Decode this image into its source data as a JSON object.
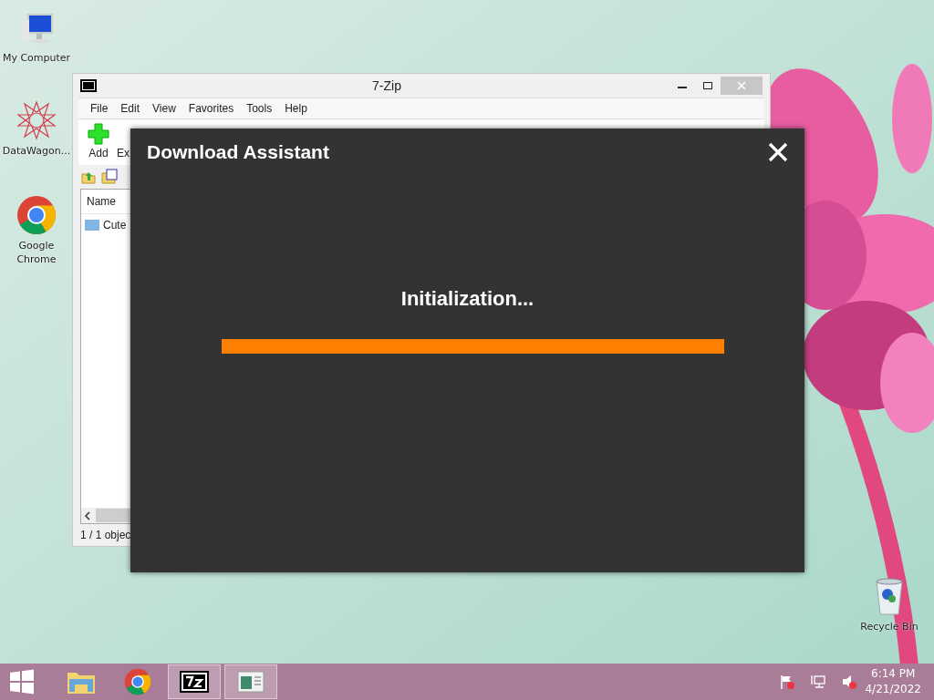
{
  "desktop_icons": [
    {
      "kind": "computer",
      "label": "My Computer"
    },
    {
      "kind": "star",
      "label": "DataWagon..."
    },
    {
      "kind": "chrome",
      "label": "Google Chrome"
    },
    {
      "kind": "bin",
      "label": "Recycle Bin"
    }
  ],
  "background_window": {
    "title": "7-Zip",
    "menu": [
      "File",
      "Edit",
      "View",
      "Favorites",
      "Tools",
      "Help"
    ],
    "toolbar": [
      "Add",
      "Ex"
    ],
    "columns": [
      "Name"
    ],
    "rows": [
      "Cute"
    ],
    "status": "1 / 1 objec"
  },
  "dialog": {
    "title": "Download Assistant",
    "message": "Initialization...",
    "progress": {
      "level": 1
    }
  },
  "taskbar": {
    "apps": [
      {
        "kind": "start",
        "active": false
      },
      {
        "kind": "folder",
        "active": false
      },
      {
        "kind": "chrome",
        "active": false
      },
      {
        "kind": "sevenzip",
        "active": true
      },
      {
        "kind": "window",
        "active": true
      }
    ],
    "time": "6:14 PM",
    "date": "4/21/2022"
  }
}
